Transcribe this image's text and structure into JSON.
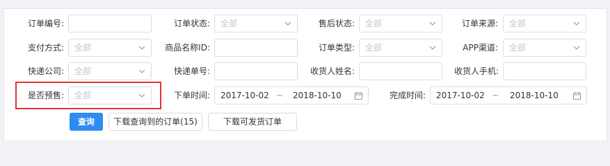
{
  "filters": {
    "order_no": {
      "label": "订单编号:",
      "value": ""
    },
    "order_status": {
      "label": "订单状态:",
      "value": "全部"
    },
    "after_sale_status": {
      "label": "售后状态:",
      "value": "全部"
    },
    "order_source": {
      "label": "订单来源:",
      "value": "全部"
    },
    "payment_method": {
      "label": "支付方式:",
      "value": "全部"
    },
    "product_name": {
      "label": "商品名称ID:",
      "value": ""
    },
    "order_type": {
      "label": "订单类型:",
      "value": "全部"
    },
    "app_channel": {
      "label": "APP渠道:",
      "value": "全部"
    },
    "courier_company": {
      "label": "快递公司:",
      "value": "全部"
    },
    "tracking_no": {
      "label": "快递单号:",
      "value": ""
    },
    "receiver_name": {
      "label": "收货人姓名:",
      "value": ""
    },
    "receiver_phone": {
      "label": "收货人手机:",
      "value": ""
    },
    "presale": {
      "label": "是否预售:",
      "value": "全部"
    },
    "order_time": {
      "label": "下单时间:",
      "start": "2017-10-02",
      "separator": "~",
      "end": "2018-10-10"
    },
    "finish_time": {
      "label": "完成时间:",
      "start": "2017-10-02",
      "separator": "~",
      "end": "2018-10-10"
    }
  },
  "actions": {
    "query_label": "查询",
    "download_query_label": "下载查询到的订单(15)",
    "download_shippable_label": "下载可发货订单"
  },
  "colors": {
    "primary": "#2d8cf0",
    "highlight_border": "#e5322d",
    "placeholder": "#c0c4cc"
  }
}
